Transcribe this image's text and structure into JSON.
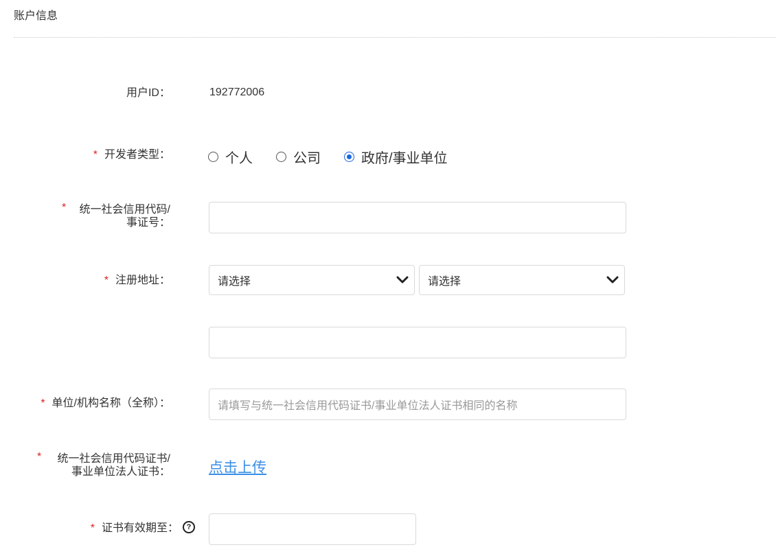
{
  "section": {
    "title": "账户信息"
  },
  "fields": {
    "user_id": {
      "label": "用户ID：",
      "value": "192772006"
    },
    "developer_type": {
      "required": "*",
      "label": "开发者类型：",
      "options": [
        "个人",
        "公司",
        "政府/事业单位"
      ],
      "selected": "政府/事业单位"
    },
    "credit_code": {
      "required": "*",
      "label_line1": "统一社会信用代码/",
      "label_line2": "事证号：",
      "value": ""
    },
    "address": {
      "required": "*",
      "label": "注册地址：",
      "select1": "请选择",
      "select2": "请选择",
      "detail_value": ""
    },
    "org_name": {
      "required": "*",
      "label": "单位/机构名称（全称）：",
      "placeholder": "请填写与统一社会信用代码证书/事业单位法人证书相同的名称"
    },
    "certificate": {
      "required": "*",
      "label_line1": "统一社会信用代码证书/",
      "label_line2": "事业单位法人证书：",
      "upload_label": "点击上传"
    },
    "cert_expiry": {
      "required": "*",
      "label": "证书有效期至：",
      "help_glyph": "?",
      "value": ""
    }
  },
  "icons": {
    "chevron": "chevron-down-icon",
    "help": "question-circle-icon"
  },
  "colors": {
    "required": "#e02020",
    "accent": "#1a66e0",
    "link": "#3a8ee6"
  }
}
